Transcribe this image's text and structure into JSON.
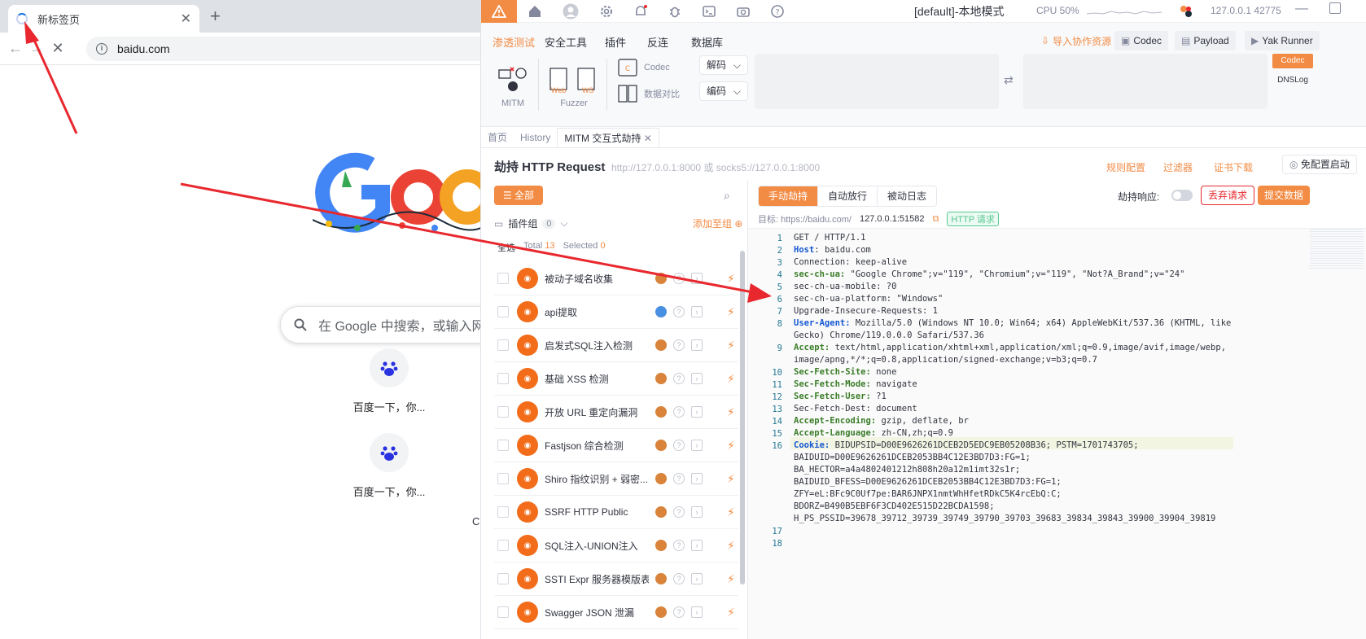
{
  "chrome": {
    "tab_title": "新标签页",
    "url": "baidu.com",
    "search_placeholder": "在 Google 中搜索，或输入网址",
    "shortcuts": [
      {
        "label": "百度一下，你..."
      },
      {
        "label": "百度一下，你..."
      }
    ],
    "stray_letter": "C"
  },
  "yakit": {
    "title": "[default]-本地模式",
    "cpu": "CPU 50%",
    "address": "127.0.0.1",
    "port": "42775",
    "menu_tabs": [
      "渗透测试",
      "安全工具",
      "插件",
      "反连",
      "数据库"
    ],
    "right_buttons": [
      "导入协作资源",
      "Codec",
      "Payload",
      "Yak Runner"
    ],
    "tools": {
      "mitm": "MITM",
      "fuzzer": "Fuzzer",
      "codec": "Codec",
      "compare": "数据对比"
    },
    "fuzzer_tags": {
      "web": "Web",
      "ws": "WS"
    },
    "decode": "解码",
    "encode": "编码",
    "side_tags": [
      "Codec",
      "DNSLog"
    ],
    "page_tabs": [
      "首页",
      "History",
      "MITM 交互式劫持"
    ],
    "header": {
      "title": "劫持 HTTP Request",
      "subtitle": "http://127.0.0.1:8000 或 socks5://127.0.0.1:8000",
      "links": [
        "规则配置",
        "过滤器",
        "证书下载"
      ],
      "free_start": "免配置启动"
    },
    "plugins": {
      "all_button": "全部",
      "group_label": "插件组",
      "group_count": "0",
      "add_to_group": "添加至组",
      "select_all": "全选",
      "total_label": "Total",
      "total": "13",
      "selected_label": "Selected",
      "selected": "0",
      "items": [
        {
          "name": "被动子域名收集",
          "tag": "orange"
        },
        {
          "name": "api提取",
          "tag": "blue"
        },
        {
          "name": "启发式SQL注入检测",
          "tag": "orange"
        },
        {
          "name": "基础 XSS 检测",
          "tag": "orange"
        },
        {
          "name": "开放 URL 重定向漏洞",
          "tag": "orange"
        },
        {
          "name": "Fastjson 综合检测",
          "tag": "orange"
        },
        {
          "name": "Shiro 指纹识别 + 弱密...",
          "tag": "orange"
        },
        {
          "name": "SSRF HTTP Public",
          "tag": "orange"
        },
        {
          "name": "SQL注入-UNION注入",
          "tag": "orange"
        },
        {
          "name": "SSTI Expr 服务器模版表...",
          "tag": "orange"
        },
        {
          "name": "Swagger JSON 泄漏",
          "tag": "orange"
        }
      ]
    },
    "request": {
      "modes": [
        "手动劫持",
        "自动放行",
        "被动日志"
      ],
      "hijack_response": "劫持响应:",
      "discard": "丢弃请求",
      "submit": "提交数据",
      "target_label": "目标:",
      "target_url": "https://baidu.com/",
      "target_ip": "127.0.0.1:51582",
      "badge": "HTTP 请求",
      "lines": [
        {
          "n": "1",
          "k": "",
          "v": "GET / HTTP/1.1"
        },
        {
          "n": "2",
          "k": "Host",
          "v": ": baidu.com"
        },
        {
          "n": "3",
          "k": "",
          "v": "Connection: keep-alive"
        },
        {
          "n": "4",
          "k": "sec-ch-ua:",
          "v": " \"Google Chrome\";v=\"119\", \"Chromium\";v=\"119\", \"Not?A_Brand\";v=\"24\""
        },
        {
          "n": "5",
          "k": "",
          "v": "sec-ch-ua-mobile: ?0"
        },
        {
          "n": "6",
          "k": "",
          "v": "sec-ch-ua-platform: \"Windows\""
        },
        {
          "n": "7",
          "k": "",
          "v": "Upgrade-Insecure-Requests: 1"
        },
        {
          "n": "8",
          "k": "User-Agent:",
          "v": " Mozilla/5.0 (Windows NT 10.0; Win64; x64) AppleWebKit/537.36 (KHTML, like"
        },
        {
          "n": "",
          "k": "",
          "v": "Gecko) Chrome/119.0.0.0 Safari/537.36"
        },
        {
          "n": "9",
          "k": "Accept:",
          "v": " text/html,application/xhtml+xml,application/xml;q=0.9,image/avif,image/webp,"
        },
        {
          "n": "",
          "k": "",
          "v": "image/apng,*/*;q=0.8,application/signed-exchange;v=b3;q=0.7"
        },
        {
          "n": "10",
          "k": "Sec-Fetch-Site:",
          "v": " none"
        },
        {
          "n": "11",
          "k": "Sec-Fetch-Mode:",
          "v": " navigate"
        },
        {
          "n": "12",
          "k": "Sec-Fetch-User:",
          "v": " ?1"
        },
        {
          "n": "13",
          "k": "",
          "v": "Sec-Fetch-Dest: document"
        },
        {
          "n": "14",
          "k": "Accept-Encoding:",
          "v": " gzip, deflate, br"
        },
        {
          "n": "15",
          "k": "Accept-Language:",
          "v": " zh-CN,zh;q=0.9"
        },
        {
          "n": "16",
          "k": "Cookie:",
          "v": " BIDUPSID=D00E9626261DCEB2D5EDC9EB05208B36; PSTM=1701743705;"
        },
        {
          "n": "",
          "k": "",
          "v": "BAIDUID=D00E9626261DCEB2053BB4C12E3BD7D3:FG=1;"
        },
        {
          "n": "",
          "k": "",
          "v": "BA_HECTOR=a4a4802401212h808h20a12m1imt32s1r;"
        },
        {
          "n": "",
          "k": "",
          "v": "BAIDUID_BFESS=D00E9626261DCEB2053BB4C12E3BD7D3:FG=1;"
        },
        {
          "n": "",
          "k": "",
          "v": "ZFY=eL:BFc9C0Uf7pe:BAR6JNPX1nmtWhHfetRDkC5K4rcEbQ:C;"
        },
        {
          "n": "",
          "k": "",
          "v": "BDORZ=B490B5EBF6F3CD402E515D22BCDA1598;"
        },
        {
          "n": "",
          "k": "",
          "v": "H_PS_PSSID=39678_39712_39739_39749_39790_39703_39683_39834_39843_39900_39904_39819"
        },
        {
          "n": "17",
          "k": "",
          "v": ""
        },
        {
          "n": "18",
          "k": "",
          "v": ""
        }
      ]
    }
  },
  "colors": {
    "accent": "#f28b44",
    "arrow": "#e8282e",
    "key_green": "#3a7d28",
    "key_blue": "#1557d4"
  }
}
